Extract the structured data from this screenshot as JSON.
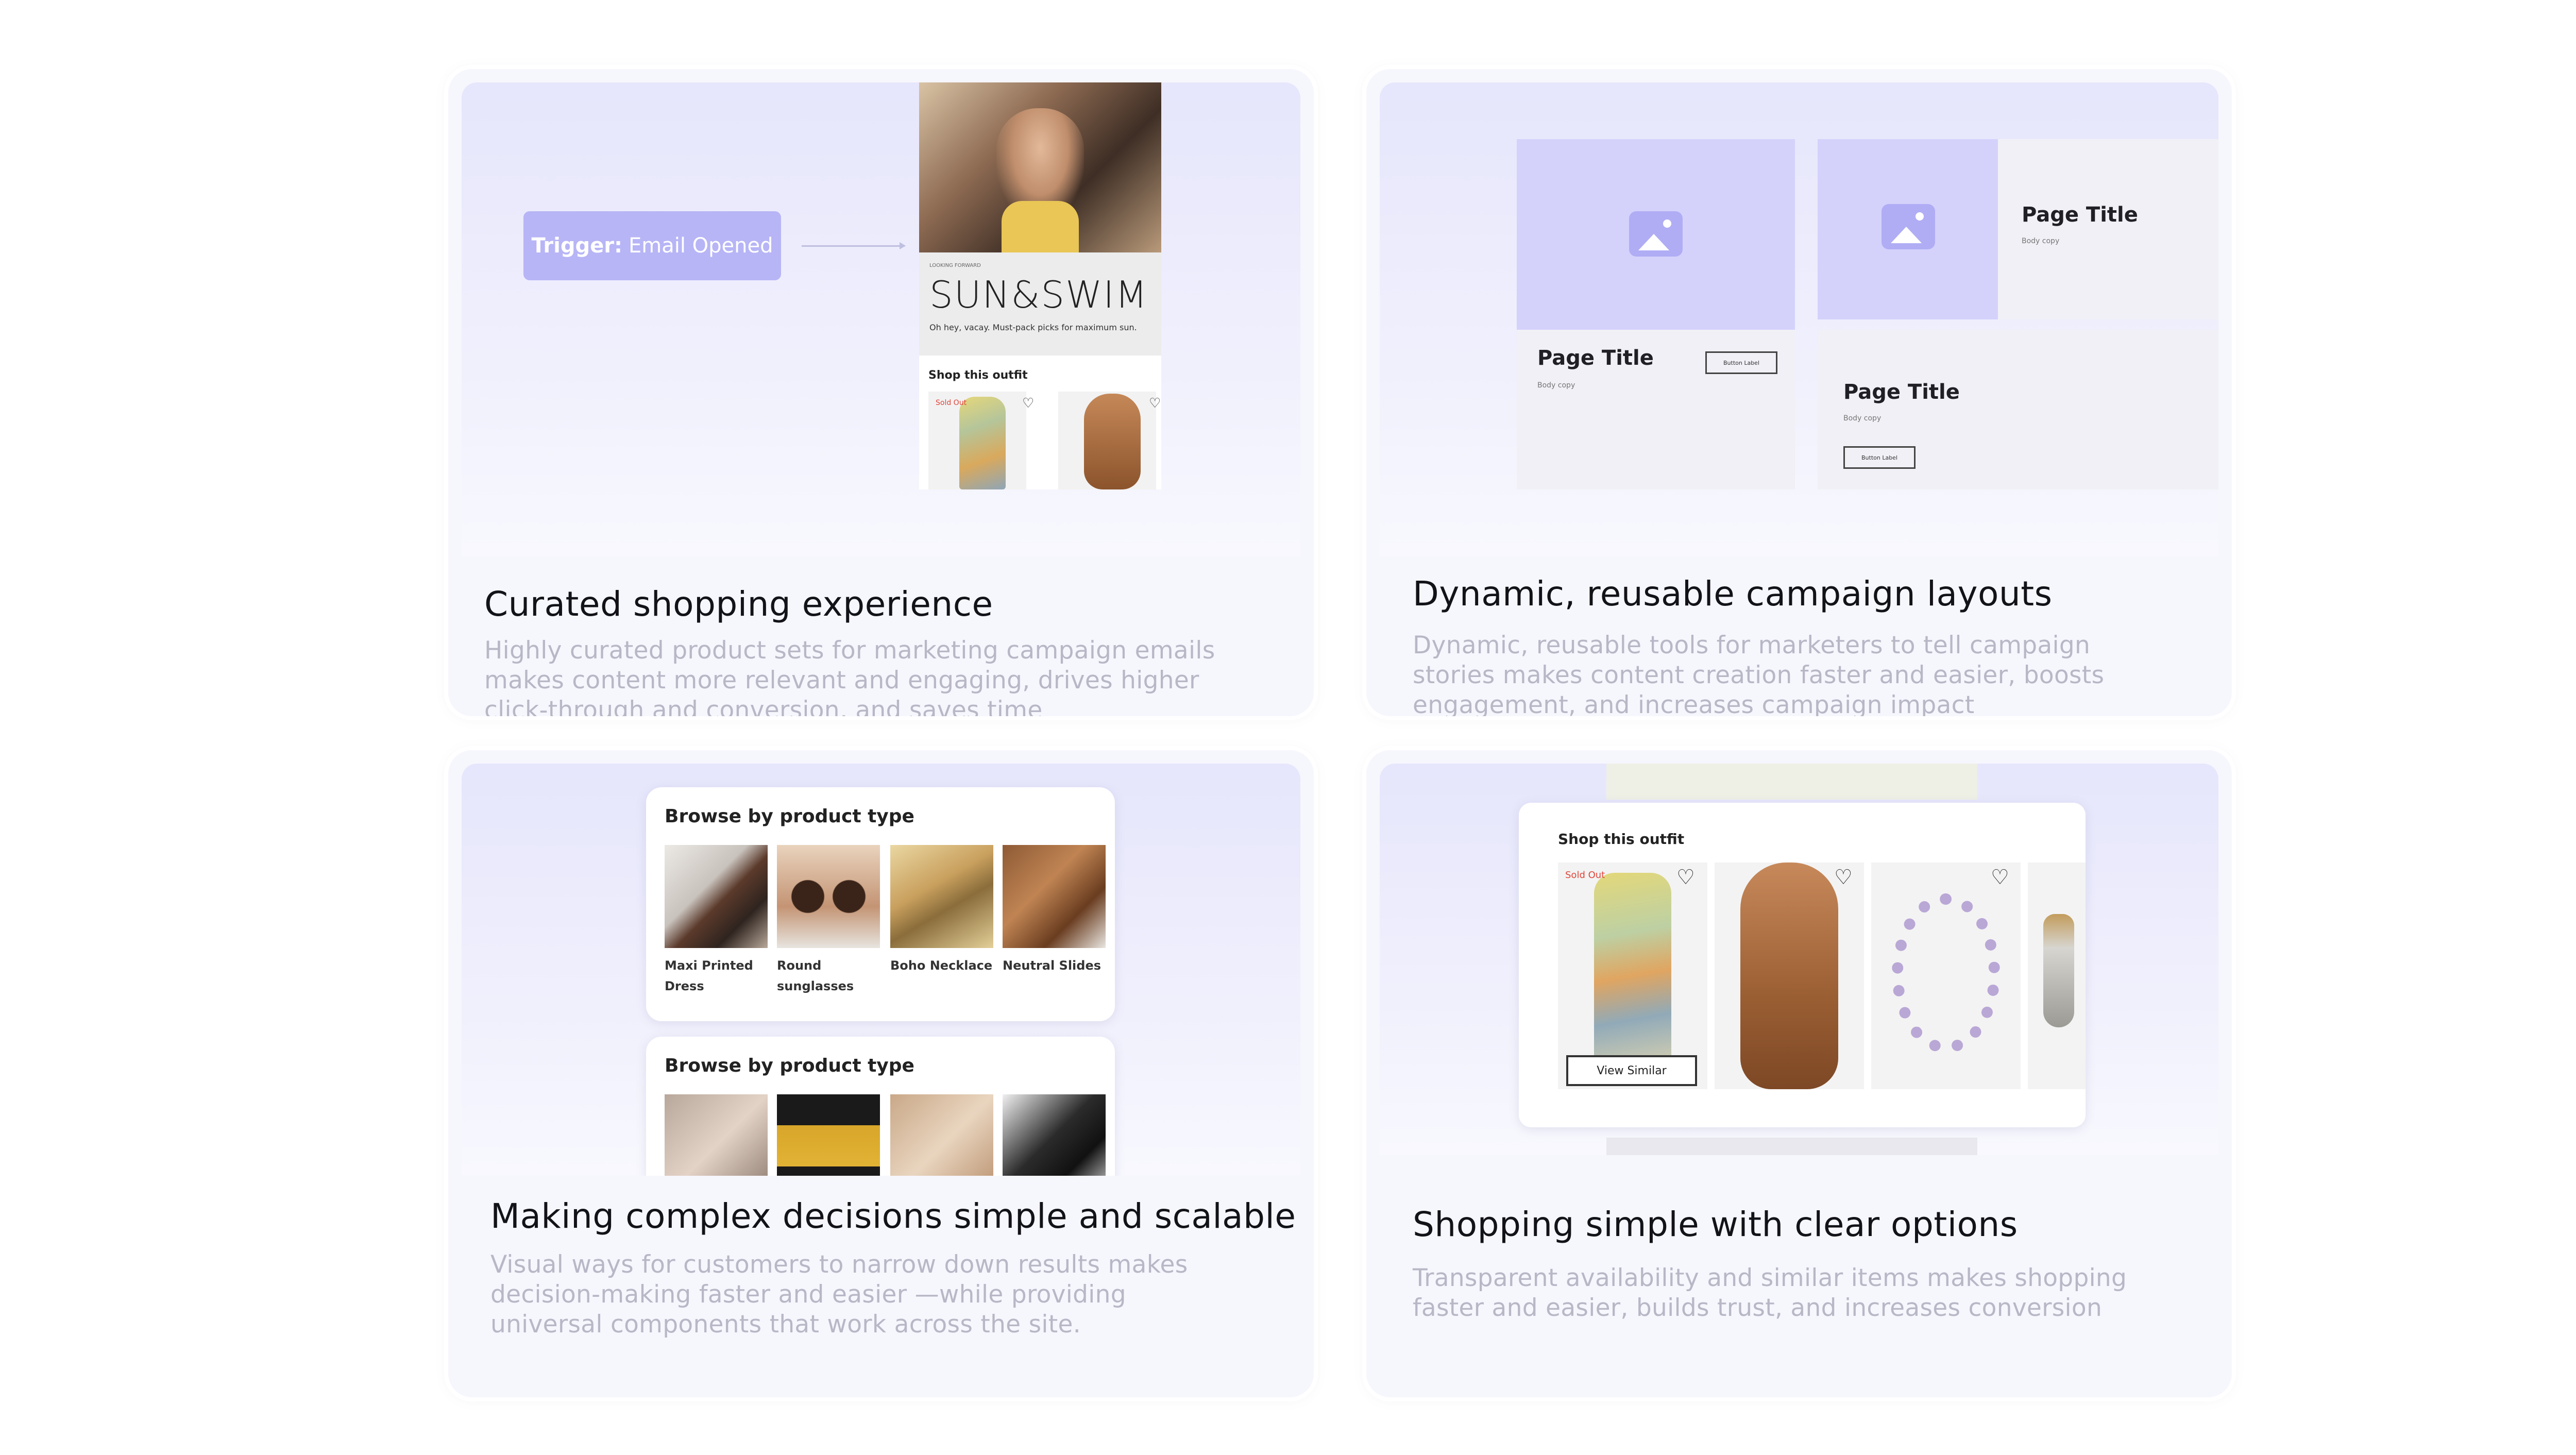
{
  "cards": [
    {
      "title": "Curated shopping experience",
      "description": "Highly curated product sets for marketing campaign emails makes content more relevant and engaging, drives higher click-through and conversion, and saves time",
      "trigger_label": "Trigger:",
      "trigger_value": "Email Opened",
      "email": {
        "kicker": "LOOKING FORWARD",
        "brand": "SUN&SWIM",
        "tagline": "Oh hey, vacay. Must-pack picks for maximum sun.",
        "shop_title": "Shop this outfit",
        "sold_out": "Sold Out"
      }
    },
    {
      "title": "Dynamic, reusable campaign layouts",
      "description": "Dynamic, reusable tools for marketers to tell campaign stories makes content creation faster and easier, boosts engagement, and increases campaign impact",
      "tiles": [
        {
          "page_title": "Page Title",
          "body": "Body copy",
          "button": "Button Label"
        },
        {
          "page_title": "Page Title",
          "body": "Body copy"
        },
        {
          "page_title": "Page Title",
          "body": "Body copy",
          "button": "Button Label"
        }
      ]
    },
    {
      "title": "Making complex decisions simple and scalable",
      "description": "Visual ways for customers to narrow down results makes decision-making faster and easier —while providing universal components that work across the site.",
      "browse_title_1": "Browse by product type",
      "browse_title_2": "Browse by product type",
      "products": [
        "Maxi Printed Dress",
        "Round sunglasses",
        "Boho Necklace",
        "Neutral Slides"
      ]
    },
    {
      "title": "Shopping simple with clear options",
      "description": "Transparent availability and similar items makes shopping faster and easier, builds trust, and increases conversion",
      "shop_title": "Shop this outfit",
      "sold_out": "Sold Out",
      "view_similar": "View Similar"
    }
  ]
}
